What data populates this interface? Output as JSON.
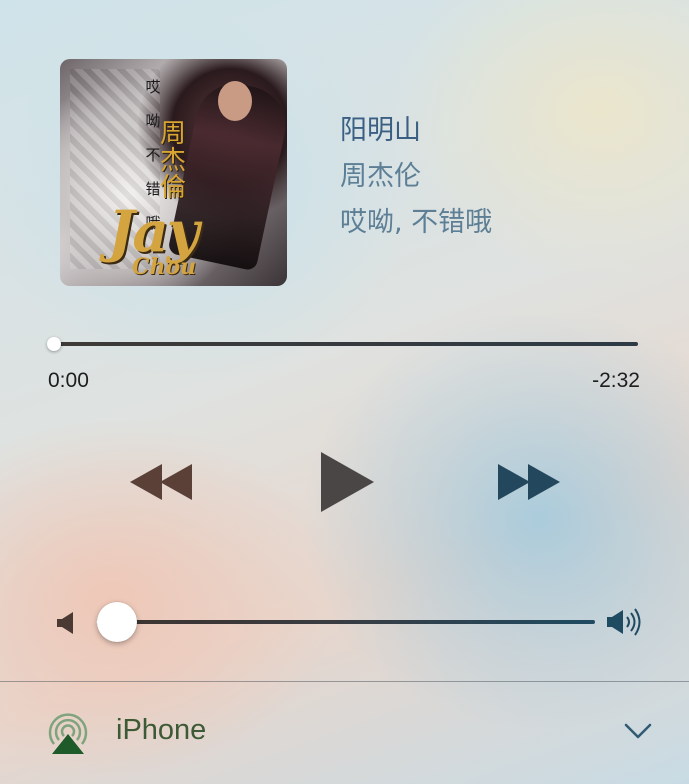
{
  "track": {
    "title": "阳明山",
    "artist": "周杰伦",
    "album": "哎呦, 不错哦"
  },
  "album_art": {
    "title_text": "周杰倫",
    "logo_text_primary": "Jay",
    "logo_text_secondary": "Chou",
    "side_text": "哎 呦 不 错 哦"
  },
  "progress": {
    "elapsed": "0:00",
    "remaining": "-2:32",
    "fraction": 0.0
  },
  "volume": {
    "level": 0.03
  },
  "airplay": {
    "device_name": "iPhone"
  },
  "icons": {
    "rewind": "rewind-icon",
    "play": "play-icon",
    "forward": "fast-forward-icon",
    "volume_low": "speaker-low-icon",
    "volume_high": "speaker-high-icon",
    "airplay": "airplay-icon",
    "expand": "chevron-down-icon"
  },
  "colors": {
    "title": "#3b5f83",
    "subtitle": "#5d7f96",
    "device": "#3d5a35",
    "rewind_fill": "#5a4036",
    "play_fill": "#4a4645",
    "forward_fill": "#23475c"
  }
}
